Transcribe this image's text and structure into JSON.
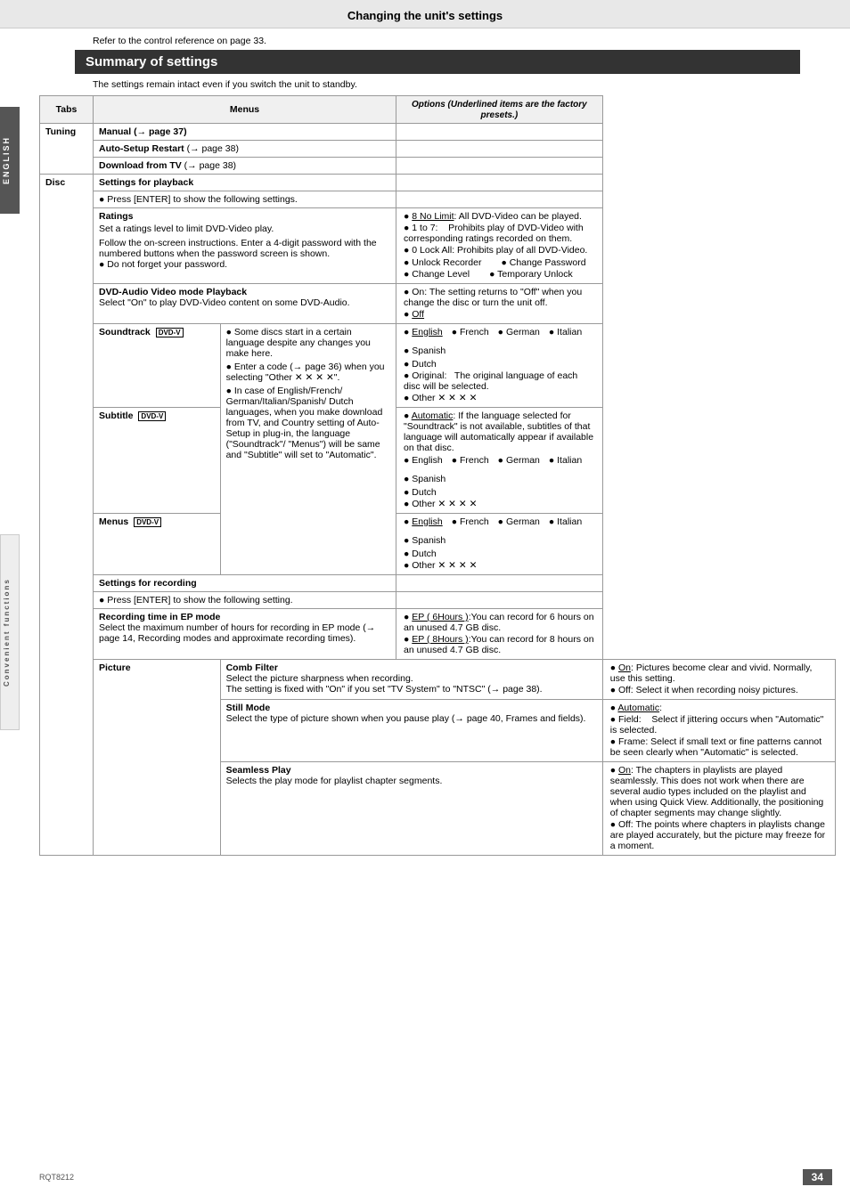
{
  "page": {
    "title": "Changing the unit's settings",
    "refer_line": "Refer to the control reference on page 33.",
    "summary_header": "Summary of settings",
    "settings_note": "The settings remain intact even if you switch the unit to standby.",
    "side_label_top": "ENGLISH",
    "side_label_bottom": "Convenient functions",
    "footer": {
      "page_number": "34",
      "model": "RQT8212"
    }
  },
  "table": {
    "col_tabs": "Tabs",
    "col_menus": "Menus",
    "col_options": "Options (Underlined items are the factory presets.)"
  }
}
